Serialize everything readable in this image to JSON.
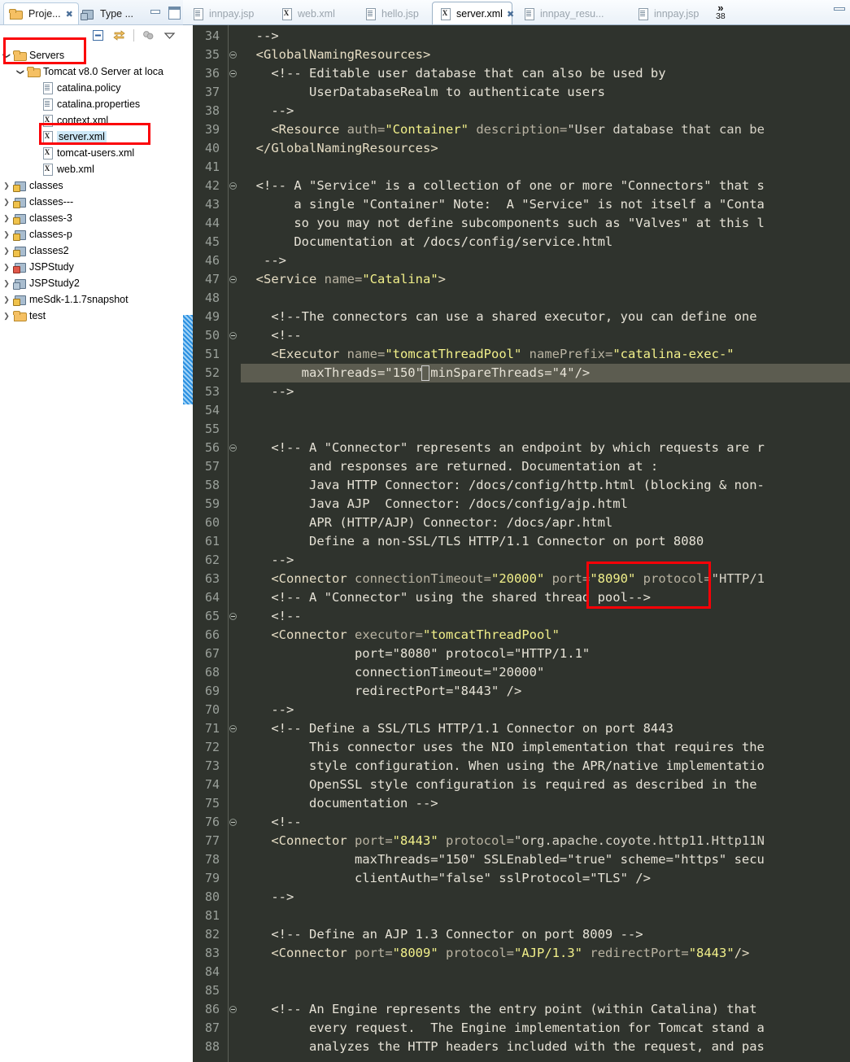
{
  "left_view": {
    "tabs": [
      {
        "label": "Proje...",
        "icon": "project-explorer-icon",
        "active": true,
        "closable": true
      },
      {
        "label": "Type ...",
        "icon": "type-hierarchy-icon",
        "active": false,
        "closable": false
      }
    ],
    "window_buttons": [
      {
        "name": "minimize-view-button",
        "icon": "minimize-icon"
      },
      {
        "name": "maximize-view-button",
        "icon": "maximize-icon"
      }
    ],
    "toolbar": [
      {
        "name": "collapse-all-button",
        "icon": "collapse-all-icon",
        "enabled": true
      },
      {
        "name": "link-with-editor-button",
        "icon": "link-with-editor-icon",
        "enabled": true
      },
      {
        "name": "view-filter-button",
        "icon": "filter-icon",
        "enabled": false
      },
      {
        "name": "view-menu-button",
        "icon": "chevron-down-icon",
        "enabled": true
      }
    ],
    "tree": [
      {
        "label": "Servers",
        "indent": 0,
        "icon": "folder-icon",
        "arrow": "open",
        "selected": false
      },
      {
        "label": "Tomcat v8.0 Server at loca",
        "indent": 1,
        "icon": "folder-icon",
        "arrow": "open",
        "selected": false
      },
      {
        "label": "catalina.policy",
        "indent": 2,
        "icon": "doc-icon",
        "arrow": "none",
        "selected": false
      },
      {
        "label": "catalina.properties",
        "indent": 2,
        "icon": "doc-icon",
        "arrow": "none",
        "selected": false
      },
      {
        "label": "context.xml",
        "indent": 2,
        "icon": "xml-icon",
        "arrow": "none",
        "selected": false
      },
      {
        "label": "server.xml",
        "indent": 2,
        "icon": "xml-icon",
        "arrow": "none",
        "selected": true
      },
      {
        "label": "tomcat-users.xml",
        "indent": 2,
        "icon": "xml-icon",
        "arrow": "none",
        "selected": false
      },
      {
        "label": "web.xml",
        "indent": 2,
        "icon": "xml-icon",
        "arrow": "none",
        "selected": false
      },
      {
        "label": "classes",
        "indent": 0,
        "icon": "package-icon",
        "arrow": "closed",
        "selected": false
      },
      {
        "label": "classes---",
        "indent": 0,
        "icon": "package-icon",
        "arrow": "closed",
        "selected": false
      },
      {
        "label": "classes-3",
        "indent": 0,
        "icon": "package-icon",
        "arrow": "closed",
        "selected": false
      },
      {
        "label": "classes-p",
        "indent": 0,
        "icon": "package-icon",
        "arrow": "closed",
        "selected": false
      },
      {
        "label": "classes2",
        "indent": 0,
        "icon": "package-icon",
        "arrow": "closed",
        "selected": false
      },
      {
        "label": "JSPStudy",
        "indent": 0,
        "icon": "package-jsp-icon",
        "arrow": "closed",
        "selected": false
      },
      {
        "label": "JSPStudy2",
        "indent": 0,
        "icon": "package-plain-icon",
        "arrow": "closed",
        "selected": false
      },
      {
        "label": "meSdk-1.1.7snapshot",
        "indent": 0,
        "icon": "package-icon",
        "arrow": "closed",
        "selected": false
      },
      {
        "label": "test",
        "indent": 0,
        "icon": "folder-icon",
        "arrow": "closed",
        "selected": false
      }
    ]
  },
  "editor": {
    "tabs": [
      {
        "label": "innpay.jsp",
        "icon": "jsp-file-icon",
        "active": false,
        "closable": false
      },
      {
        "label": "web.xml",
        "icon": "xml-file-icon",
        "active": false,
        "closable": false
      },
      {
        "label": "hello.jsp",
        "icon": "jsp-file-icon",
        "active": false,
        "closable": false
      },
      {
        "label": "server.xml",
        "icon": "xml-file-icon",
        "active": true,
        "closable": true
      },
      {
        "label": "innpay_resu...",
        "icon": "jsp-file-icon",
        "active": false,
        "closable": false
      },
      {
        "label": "innpay.jsp",
        "icon": "jsp-file-icon",
        "active": false,
        "closable": false
      }
    ],
    "overflow_chevron": "»",
    "overflow_count": "38",
    "minimize_button": "minimize-editor-icon",
    "first_line_number": 34,
    "highlighted_line": 52,
    "lines": [
      {
        "n": 34,
        "fold": false,
        "text": "  -->"
      },
      {
        "n": 35,
        "fold": true,
        "text": "  <GlobalNamingResources>"
      },
      {
        "n": 36,
        "fold": true,
        "text": "    <!-- Editable user database that can also be used by"
      },
      {
        "n": 37,
        "fold": false,
        "text": "         UserDatabaseRealm to authenticate users"
      },
      {
        "n": 38,
        "fold": false,
        "text": "    -->"
      },
      {
        "n": 39,
        "fold": false,
        "text": "    <Resource auth=\"Container\" description=\"User database that can be"
      },
      {
        "n": 40,
        "fold": false,
        "text": "  </GlobalNamingResources>"
      },
      {
        "n": 41,
        "fold": false,
        "text": ""
      },
      {
        "n": 42,
        "fold": true,
        "text": "  <!-- A \"Service\" is a collection of one or more \"Connectors\" that s"
      },
      {
        "n": 43,
        "fold": false,
        "text": "       a single \"Container\" Note:  A \"Service\" is not itself a \"Conta"
      },
      {
        "n": 44,
        "fold": false,
        "text": "       so you may not define subcomponents such as \"Valves\" at this l"
      },
      {
        "n": 45,
        "fold": false,
        "text": "       Documentation at /docs/config/service.html"
      },
      {
        "n": 46,
        "fold": false,
        "text": "   -->"
      },
      {
        "n": 47,
        "fold": true,
        "text": "  <Service name=\"Catalina\">"
      },
      {
        "n": 48,
        "fold": false,
        "text": ""
      },
      {
        "n": 49,
        "fold": false,
        "text": "    <!--The connectors can use a shared executor, you can define one"
      },
      {
        "n": 50,
        "fold": true,
        "text": "    <!--"
      },
      {
        "n": 51,
        "fold": false,
        "text": "    <Executor name=\"tomcatThreadPool\" namePrefix=\"catalina-exec-\""
      },
      {
        "n": 52,
        "fold": false,
        "text": "        maxThreads=\"150\" minSpareThreads=\"4\"/>"
      },
      {
        "n": 53,
        "fold": false,
        "text": "    -->"
      },
      {
        "n": 54,
        "fold": false,
        "text": ""
      },
      {
        "n": 55,
        "fold": false,
        "text": ""
      },
      {
        "n": 56,
        "fold": true,
        "text": "    <!-- A \"Connector\" represents an endpoint by which requests are r"
      },
      {
        "n": 57,
        "fold": false,
        "text": "         and responses are returned. Documentation at :"
      },
      {
        "n": 58,
        "fold": false,
        "text": "         Java HTTP Connector: /docs/config/http.html (blocking & non-"
      },
      {
        "n": 59,
        "fold": false,
        "text": "         Java AJP  Connector: /docs/config/ajp.html"
      },
      {
        "n": 60,
        "fold": false,
        "text": "         APR (HTTP/AJP) Connector: /docs/apr.html"
      },
      {
        "n": 61,
        "fold": false,
        "text": "         Define a non-SSL/TLS HTTP/1.1 Connector on port 8080"
      },
      {
        "n": 62,
        "fold": false,
        "text": "    -->"
      },
      {
        "n": 63,
        "fold": false,
        "text": "    <Connector connectionTimeout=\"20000\" port=\"8090\" protocol=\"HTTP/1"
      },
      {
        "n": 64,
        "fold": false,
        "text": "    <!-- A \"Connector\" using the shared thread pool-->"
      },
      {
        "n": 65,
        "fold": true,
        "text": "    <!--"
      },
      {
        "n": 66,
        "fold": false,
        "text": "    <Connector executor=\"tomcatThreadPool\""
      },
      {
        "n": 67,
        "fold": false,
        "text": "               port=\"8080\" protocol=\"HTTP/1.1\""
      },
      {
        "n": 68,
        "fold": false,
        "text": "               connectionTimeout=\"20000\""
      },
      {
        "n": 69,
        "fold": false,
        "text": "               redirectPort=\"8443\" />"
      },
      {
        "n": 70,
        "fold": false,
        "text": "    -->"
      },
      {
        "n": 71,
        "fold": true,
        "text": "    <!-- Define a SSL/TLS HTTP/1.1 Connector on port 8443"
      },
      {
        "n": 72,
        "fold": false,
        "text": "         This connector uses the NIO implementation that requires the"
      },
      {
        "n": 73,
        "fold": false,
        "text": "         style configuration. When using the APR/native implementatio"
      },
      {
        "n": 74,
        "fold": false,
        "text": "         OpenSSL style configuration is required as described in the"
      },
      {
        "n": 75,
        "fold": false,
        "text": "         documentation -->"
      },
      {
        "n": 76,
        "fold": true,
        "text": "    <!--"
      },
      {
        "n": 77,
        "fold": false,
        "text": "    <Connector port=\"8443\" protocol=\"org.apache.coyote.http11.Http11N"
      },
      {
        "n": 78,
        "fold": false,
        "text": "               maxThreads=\"150\" SSLEnabled=\"true\" scheme=\"https\" secu"
      },
      {
        "n": 79,
        "fold": false,
        "text": "               clientAuth=\"false\" sslProtocol=\"TLS\" />"
      },
      {
        "n": 80,
        "fold": false,
        "text": "    -->"
      },
      {
        "n": 81,
        "fold": false,
        "text": ""
      },
      {
        "n": 82,
        "fold": false,
        "text": "    <!-- Define an AJP 1.3 Connector on port 8009 -->"
      },
      {
        "n": 83,
        "fold": false,
        "text": "    <Connector port=\"8009\" protocol=\"AJP/1.3\" redirectPort=\"8443\"/>"
      },
      {
        "n": 84,
        "fold": false,
        "text": ""
      },
      {
        "n": 85,
        "fold": false,
        "text": ""
      },
      {
        "n": 86,
        "fold": true,
        "text": "    <!-- An Engine represents the entry point (within Catalina) that"
      },
      {
        "n": 87,
        "fold": false,
        "text": "         every request.  The Engine implementation for Tomcat stand a"
      },
      {
        "n": 88,
        "fold": false,
        "text": "         analyzes the HTTP headers included with the request, and pas"
      }
    ]
  },
  "annotations": {
    "accent_color": "#fb0007",
    "boxes": [
      {
        "name": "servers-node-highlight-box"
      },
      {
        "name": "server-xml-file-highlight-box"
      },
      {
        "name": "port-8090-highlight-box"
      }
    ]
  },
  "theme": {
    "editor_background": "#2f332d",
    "editor_foreground": "#d8d4c8",
    "line_number_color": "#9aa09a",
    "attribute_value_color": "#f2f08a",
    "current_line_background": "#5c5c50",
    "selection_background": "#cde8f7",
    "change_marker_color": "#2a8fe0"
  }
}
